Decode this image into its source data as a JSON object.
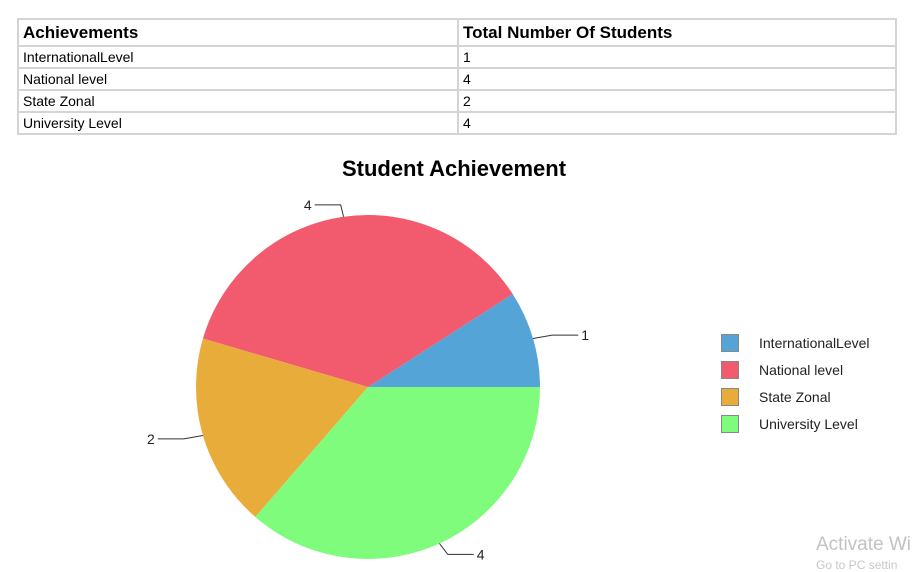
{
  "table": {
    "headers": [
      "Achievements",
      "Total Number Of Students"
    ],
    "rows": [
      [
        "InternationalLevel",
        "1"
      ],
      [
        "National level",
        "4"
      ],
      [
        "State Zonal",
        "2"
      ],
      [
        "University Level",
        "4"
      ]
    ]
  },
  "chart_data": {
    "type": "pie",
    "title": "Student Achievement",
    "categories": [
      "InternationalLevel",
      "National level",
      "State Zonal",
      "University Level"
    ],
    "values": [
      1,
      4,
      2,
      4
    ],
    "colors": [
      "#55a4d8",
      "#f25a6e",
      "#e8ac3a",
      "#80fc7c"
    ],
    "data_labels": [
      "1",
      "4",
      "2",
      "4"
    ],
    "legend_position": "right"
  },
  "watermark": {
    "line1": "Activate Wi",
    "line2": "Go to PC settin"
  }
}
